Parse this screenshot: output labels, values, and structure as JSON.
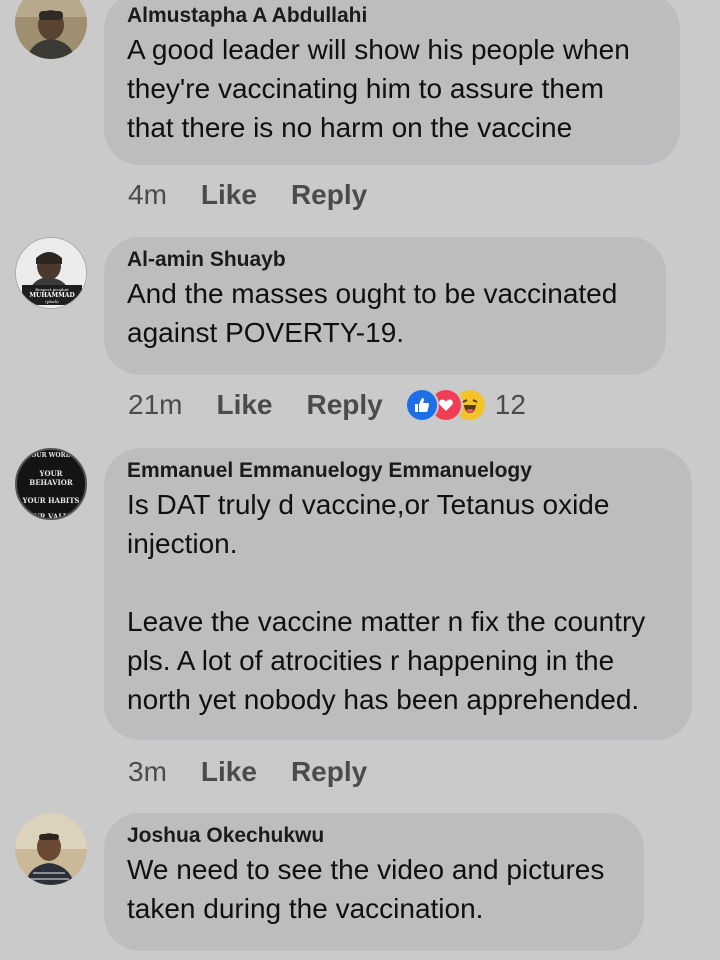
{
  "comments": [
    {
      "author": "Almustapha A Abdullahi",
      "text": "A good leader will show his people when they're vaccinating him to assure them that there is no harm on the vaccine",
      "time": "4m",
      "like_label": "Like",
      "reply_label": "Reply"
    },
    {
      "author": "Al-amin Shuayb",
      "text": "And the masses ought to be vaccinated against POVERTY-19.",
      "time": "21m",
      "like_label": "Like",
      "reply_label": "Reply",
      "reaction_icons": [
        "like-icon",
        "love-icon",
        "haha-icon"
      ],
      "reaction_count": "12",
      "avatar_text": [
        "Respect prophet",
        "MUHAMMAD",
        "(pbuh)"
      ]
    },
    {
      "author": "Emmanuel Emmanuelogy Emmanuelogy",
      "text": "Is DAT truly d vaccine,or Tetanus oxide injection.\n\nLeave the vaccine matter n fix the country pls. A lot of atrocities r happening in the north yet nobody has been apprehended.",
      "time": "3m",
      "like_label": "Like",
      "reply_label": "Reply",
      "avatar_text": [
        "YOUR WORDS",
        "YOUR BEHAVIOR",
        "YOUR HABITS",
        "YOUR VALUES"
      ]
    },
    {
      "author": "Joshua Okechukwu",
      "text": "We need to see the video and pictures taken during the vaccination."
    }
  ],
  "colors": {
    "background": "#cacacb",
    "bubble": "#bdbdbf",
    "like_reaction": "#1d6fe8",
    "love_reaction": "#ef3e55",
    "haha_reaction": "#f4c32a"
  }
}
